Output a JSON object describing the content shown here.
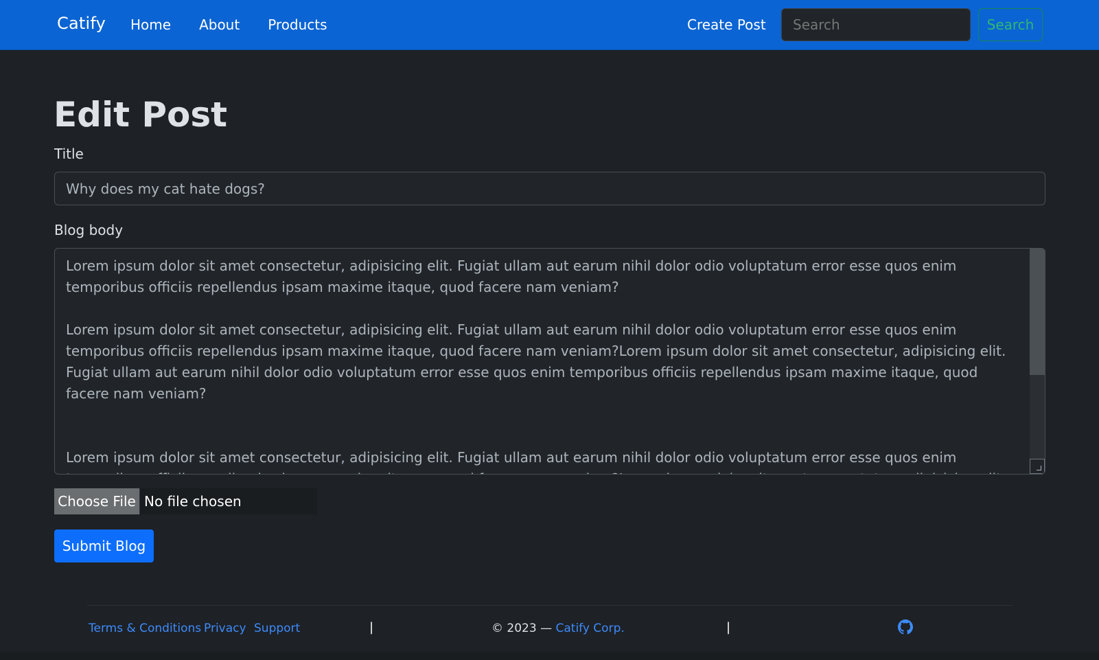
{
  "navbar": {
    "brand": "Catify",
    "links": [
      "Home",
      "About",
      "Products"
    ],
    "create_post": "Create Post",
    "search_placeholder": "Search",
    "search_button": "Search"
  },
  "main": {
    "page_title": "Edit Post",
    "title_label": "Title",
    "title_value": "Why does my cat hate dogs?",
    "body_label": "Blog body",
    "body_paragraphs": [
      "Lorem ipsum dolor sit amet consectetur, adipisicing elit. Fugiat ullam aut earum nihil dolor odio voluptatum error esse quos enim temporibus officiis repellendus ipsam maxime itaque, quod facere nam veniam?",
      "Lorem ipsum dolor sit amet consectetur, adipisicing elit. Fugiat ullam aut earum nihil dolor odio voluptatum error esse quos enim temporibus officiis repellendus ipsam maxime itaque, quod facere nam veniam?Lorem ipsum dolor sit amet consectetur, adipisicing elit. Fugiat ullam aut earum nihil dolor odio voluptatum error esse quos enim temporibus officiis repellendus ipsam maxime itaque, quod facere nam veniam?",
      "Lorem ipsum dolor sit amet consectetur, adipisicing elit. Fugiat ullam aut earum nihil dolor odio voluptatum error esse quos enim temporibus officiis repellendus ipsam maxime itaque, quod facere nam veniam?Lorem ipsum dolor sit amet consectetur, adipisicing elit. Fugiat ullam aut earum nihil dolor"
    ],
    "file_button": "Choose File",
    "file_status": "No file chosen",
    "submit_button": "Submit Blog"
  },
  "footer": {
    "links": [
      "Terms & Conditions",
      "Privacy",
      "Support"
    ],
    "separator": "|",
    "copyright_prefix": "© 2023 — ",
    "copyright_corp": "Catify Corp.",
    "icon": "github-icon"
  },
  "colors": {
    "navbar": "#0b64d3",
    "background": "#1e2125",
    "link": "#3d8bfd",
    "primary_button": "#0d6efd",
    "search_button": "#198754"
  }
}
